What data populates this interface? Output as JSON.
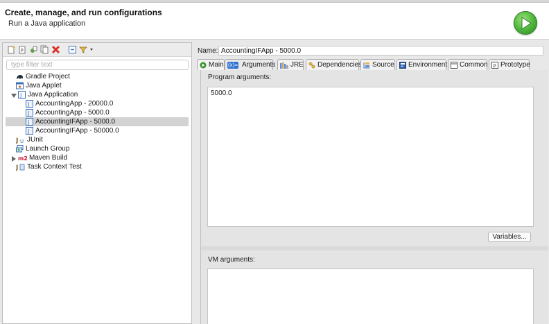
{
  "header": {
    "title": "Create, manage, and run configurations",
    "subtitle": "Run a Java application",
    "run_icon": "run-play-icon"
  },
  "toolbar": {
    "icons": [
      "new-configuration-icon",
      "new-prototype-icon",
      "export-icon",
      "duplicate-icon",
      "delete-icon",
      "collapse-all-icon",
      "filter-icon"
    ]
  },
  "filter": {
    "placeholder": "type filter text",
    "value": ""
  },
  "tree": {
    "gradle": "Gradle Project",
    "applet": "Java Applet",
    "java_app": "Java Application",
    "children": [
      "AccountingApp - 20000.0",
      "AccountingApp - 5000.0",
      "AccountingIFApp - 5000.0",
      "AccountingIFApp - 50000.0"
    ],
    "selected": "AccountingIFApp - 5000.0",
    "junit": "JUnit",
    "launch_group": "Launch Group",
    "maven": "Maven Build",
    "task_context": "Task Context Test"
  },
  "config": {
    "name_label": "Name:",
    "name_value": "AccountingIFApp - 5000.0"
  },
  "tabs": [
    "Main",
    "Arguments",
    "JRE",
    "Dependencies",
    "Source",
    "Environment",
    "Common",
    "Prototype"
  ],
  "active_tab": "Arguments",
  "arguments": {
    "program_label": "Program arguments:",
    "program_value": "5000.0",
    "variables_button": "Variables...",
    "vm_label": "VM arguments:",
    "vm_value": ""
  },
  "colors": {
    "selection": "#d3d3d3",
    "run_green": "#4bb33a",
    "delete_red": "#d9302b",
    "maven_red": "#c8102e"
  }
}
